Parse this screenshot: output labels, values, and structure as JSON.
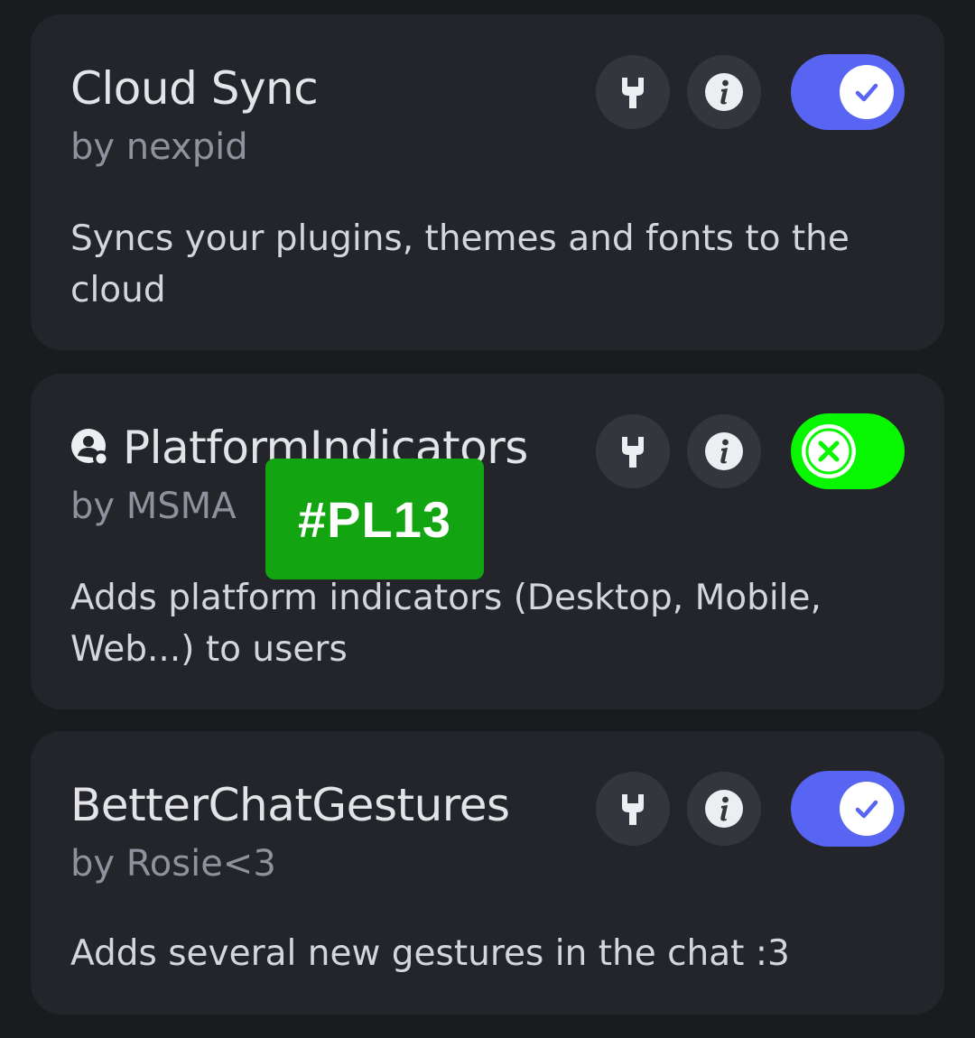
{
  "plugins": [
    {
      "name": "Cloud Sync",
      "author": "by nexpid",
      "description": "Syncs your plugins, themes and fonts to the cloud",
      "enabled": true
    },
    {
      "name": "PlatformIndicators",
      "author": "by MSMA",
      "description": "Adds platform indicators (Desktop, Mobile, Web...) to users",
      "enabled": false,
      "badge_icon": "user-status-icon"
    },
    {
      "name": "BetterChatGestures",
      "author": "by Rosie<3",
      "description": "Adds several new gestures in the chat :3",
      "enabled": true
    }
  ],
  "overlay_tag": "#PL13",
  "icons": {
    "settings": "wrench-icon",
    "info": "info-icon",
    "enabled": "check-icon",
    "disabled": "x-icon"
  },
  "colors": {
    "toggle_on": "#5865f2",
    "toggle_off": "#08f700",
    "tag": "#12a511"
  }
}
